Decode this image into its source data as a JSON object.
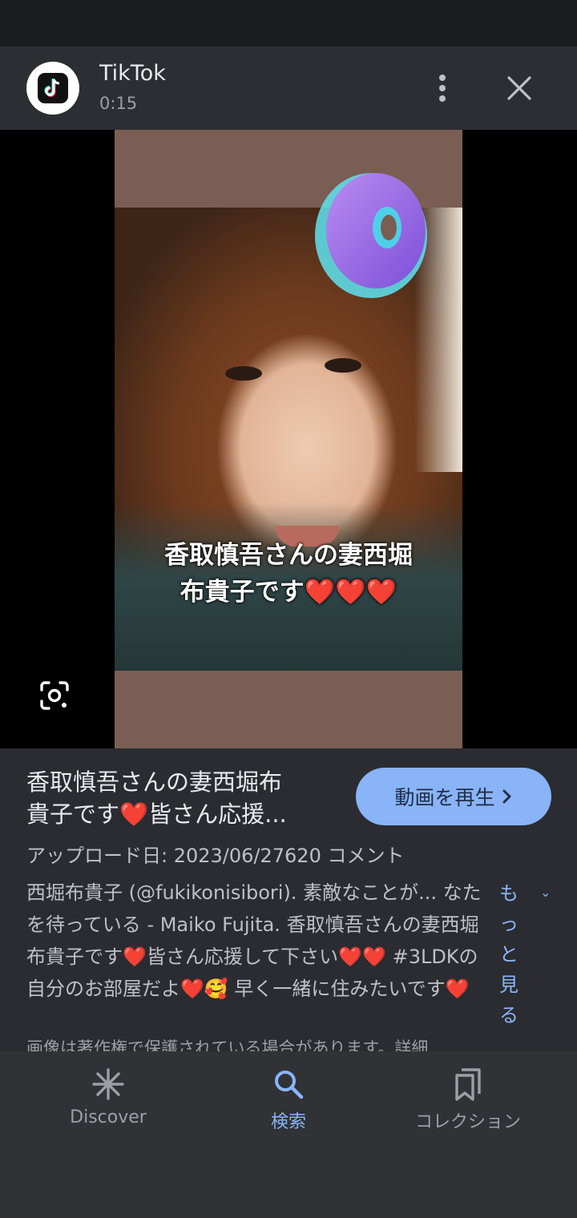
{
  "header": {
    "app_name": "TikTok",
    "duration": "0:15"
  },
  "video": {
    "caption_line1": "香取慎吾さんの妻西堀",
    "caption_line2": "布貴子です",
    "caption_hearts": "❤️❤️❤️"
  },
  "info": {
    "title_line1": "香取慎吾さんの妻西堀布",
    "title_line2a": "貴子です",
    "title_heart": "❤️",
    "title_line2b": "皆さん応援...",
    "play_button": "動画を再生",
    "upload_meta": "アップロード日: 2023/06/27620 コメント",
    "description_part1": "西堀布貴子 (@fukikonisibori). 素敵なことが... なたを待っている - Maiko Fujita. 香取慎吾さんの妻西堀布貴子です",
    "description_heart1": "❤️",
    "description_part2": "皆さん応援して下さい",
    "description_hearts2": "❤️❤️",
    "description_part3": "#3LDKの自分のお部屋だよ",
    "description_heart3": "❤️",
    "description_emoji": "🥰",
    "description_part4": "早く一緒に住みたいです",
    "description_heart4": "❤️",
    "more_link": "もっと見る",
    "copyright": "画像は著作権で保護されている場合があります。詳細"
  },
  "bottom_nav": {
    "items": [
      {
        "label": "Discover",
        "icon": "asterisk-icon",
        "active": false
      },
      {
        "label": "検索",
        "icon": "search-icon",
        "active": true
      },
      {
        "label": "コレクション",
        "icon": "bookmarks-icon",
        "active": false
      }
    ]
  },
  "colors": {
    "accent": "#8ab4f8",
    "background": "#2a2c31",
    "heart": "#e0262c"
  }
}
